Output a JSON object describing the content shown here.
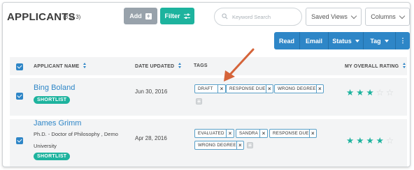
{
  "header": {
    "title": "APPLICANTS",
    "count": "(3 of 3)",
    "add_label": "Add",
    "filter_label": "Filter",
    "search_placeholder": "Keyword Search",
    "saved_views_label": "Saved Views",
    "columns_label": "Columns"
  },
  "actions": {
    "read": "Read",
    "email": "Email",
    "status": "Status",
    "tag": "Tag",
    "more": "⋮"
  },
  "columns": {
    "name": "APPLICANT NAME",
    "date": "DATE UPDATED",
    "tags": "TAGS",
    "rating": "MY OVERALL RATING"
  },
  "rows": [
    {
      "name": "Bing Boland",
      "subtitle": "",
      "badge": "SHORTLIST",
      "date": "Jun 30, 2016",
      "tags": [
        "DRAFT",
        "RESPONSE DUE",
        "WRONG DEGREE"
      ],
      "rating": 3,
      "max_rating": 5
    },
    {
      "name": "James Grimm",
      "subtitle_line1": "Ph.D. - Doctor of Philosophy , Demo",
      "subtitle_line2": "University",
      "badge": "SHORTLIST",
      "date": "Apr 28, 2016",
      "tags": [
        "EVALUATED",
        "SANDRA",
        "RESPONSE DUE",
        "WRONG DEGREE"
      ],
      "rating": 4,
      "max_rating": 5
    }
  ],
  "colors": {
    "accent_blue": "#2e86c7",
    "accent_teal": "#1db39e",
    "arrow": "#d5643a"
  }
}
